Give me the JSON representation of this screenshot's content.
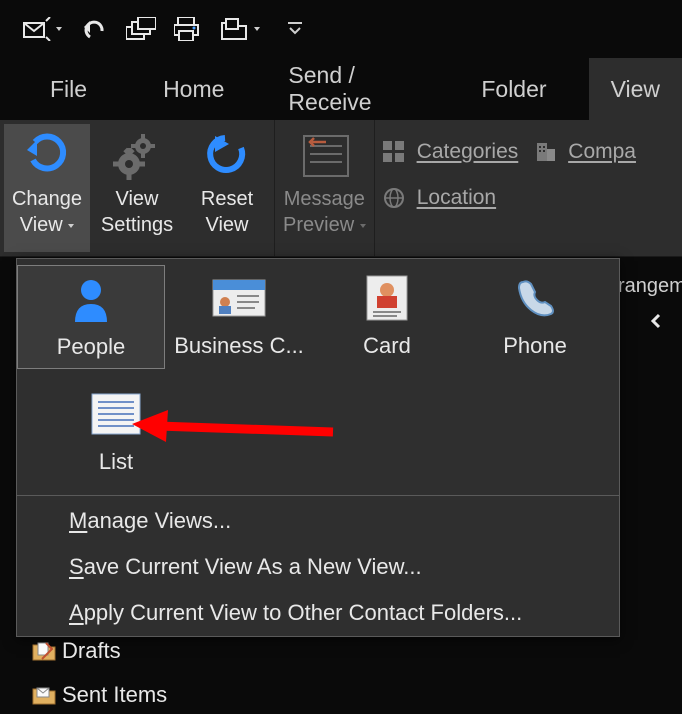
{
  "qat": {
    "items": [
      "send-receive",
      "undo",
      "windows",
      "print",
      "open-folder",
      "more"
    ]
  },
  "tabs": {
    "file": "File",
    "home": "Home",
    "sendreceive": "Send / Receive",
    "folder": "Folder",
    "view": "View"
  },
  "ribbon": {
    "change_view": {
      "line1": "Change",
      "line2": "View"
    },
    "view_settings": {
      "line1": "View",
      "line2": "Settings"
    },
    "reset_view": {
      "line1": "Reset",
      "line2": "View"
    },
    "message_preview": {
      "line1": "Message",
      "line2": "Preview"
    },
    "categories": "Categories",
    "companies": "Compa",
    "location": "Location"
  },
  "gallery": {
    "people": "People",
    "business": "Business C...",
    "card": "Card",
    "phone": "Phone",
    "list": "List",
    "menu": {
      "manage": {
        "pre": "",
        "key": "M",
        "rest": "anage Views..."
      },
      "save": {
        "pre": "",
        "key": "S",
        "rest": "ave Current View As a New View..."
      },
      "apply": {
        "pre": "",
        "key": "A",
        "rest": "pply Current View to Other Contact Folders..."
      }
    }
  },
  "right": {
    "arrangement": "rangem"
  },
  "folders": {
    "drafts": "Drafts",
    "sent": "Sent Items"
  }
}
